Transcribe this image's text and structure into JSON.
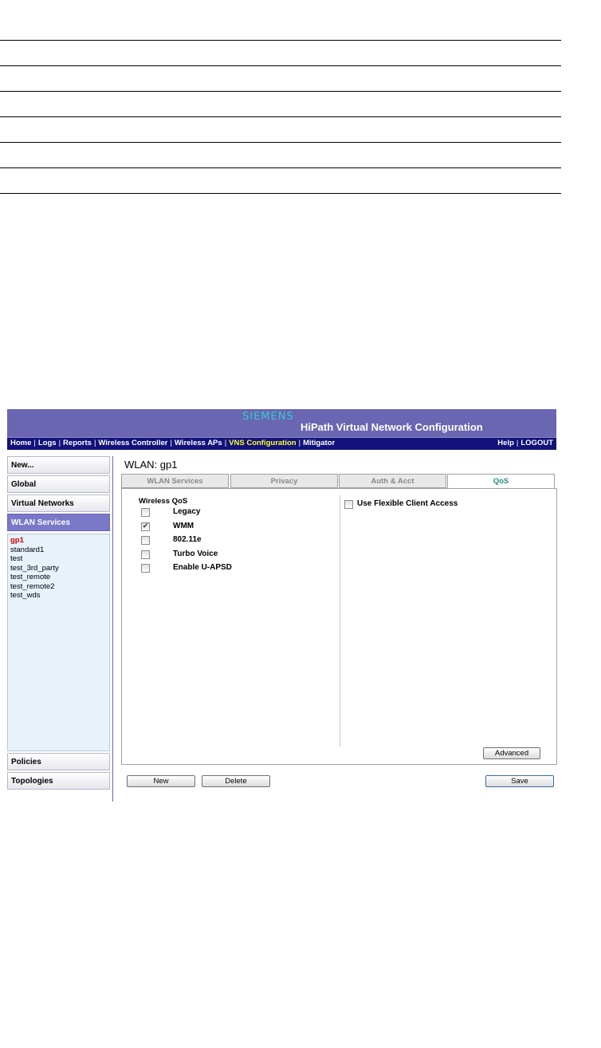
{
  "header": {
    "brand": "SIEMENS",
    "app_title": "HiPath Virtual Network Configuration"
  },
  "nav": {
    "left": [
      "Home",
      "Logs",
      "Reports",
      "Wireless Controller",
      "Wireless APs",
      "VNS Configuration",
      "Mitigator"
    ],
    "active": "VNS Configuration",
    "right": [
      "Help",
      "LOGOUT"
    ]
  },
  "sidebar": {
    "new": "New...",
    "global": "Global",
    "virtual_networks": "Virtual Networks",
    "wlan_services": "WLAN Services",
    "wlan_list": [
      "gp1",
      "standard1",
      "test",
      "test_3rd_party",
      "test_remote",
      "test_remote2",
      "test_wds"
    ],
    "selected": "gp1",
    "policies": "Policies",
    "topologies": "Topologies"
  },
  "page": {
    "title": "WLAN: gp1",
    "tabs": [
      "WLAN Services",
      "Privacy",
      "Auth & Acct",
      "QoS"
    ],
    "active_tab": "QoS"
  },
  "qos": {
    "group_title": "Wireless QoS",
    "options": [
      {
        "label": "Legacy",
        "checked": false
      },
      {
        "label": "WMM",
        "checked": true
      },
      {
        "label": "802.11e",
        "checked": false
      },
      {
        "label": "Turbo Voice",
        "checked": false
      },
      {
        "label": "Enable U-APSD",
        "checked": false
      }
    ],
    "flexible_access_label": "Use Flexible Client Access",
    "flexible_access_checked": false,
    "advanced_label": "Advanced"
  },
  "footer": {
    "new_label": "New",
    "delete_label": "Delete",
    "save_label": "Save"
  }
}
